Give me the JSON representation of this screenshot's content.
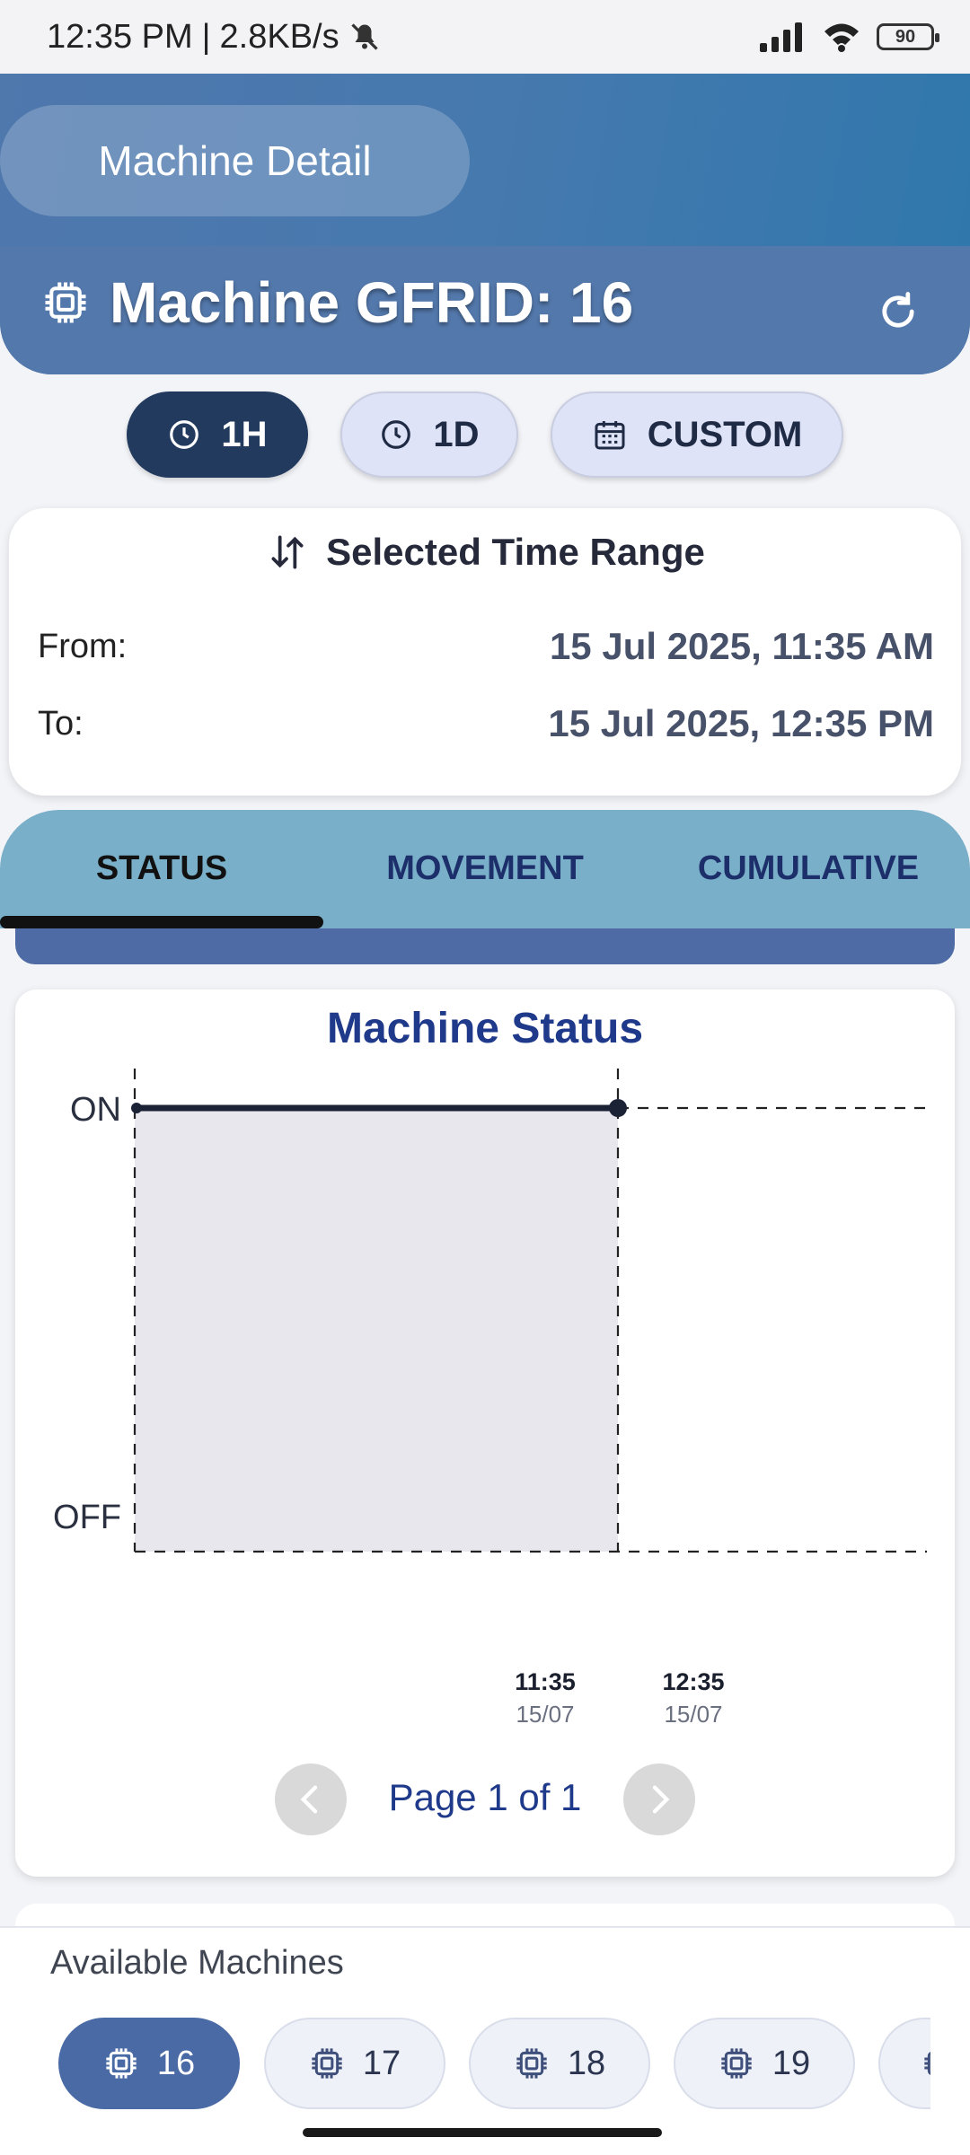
{
  "status_bar": {
    "time": "12:35 PM",
    "network_speed": "2.8KB/s",
    "battery": "90"
  },
  "header": {
    "page_title": "Machine Detail",
    "machine_title": "Machine GFRID: 16"
  },
  "range_chips": {
    "one_hour": "1H",
    "one_day": "1D",
    "custom": "CUSTOM"
  },
  "time_range": {
    "heading": "Selected Time Range",
    "from_label": "From:",
    "from_value": "15 Jul 2025, 11:35 AM",
    "to_label": "To:",
    "to_value": "15 Jul 2025, 12:35 PM"
  },
  "tabs": {
    "status": "STATUS",
    "movement": "MOVEMENT",
    "cumulative": "CUMULATIVE"
  },
  "chart": {
    "title": "Machine Status",
    "pager": "Page 1 of 1"
  },
  "chart_data": {
    "type": "line",
    "title": "Machine Status",
    "y_categories": [
      "OFF",
      "ON"
    ],
    "ticks": [
      {
        "time": "11:35",
        "date": "15/07"
      },
      {
        "time": "12:35",
        "date": "15/07"
      }
    ],
    "series": [
      {
        "points": [
          {
            "x": "11:35",
            "y": "ON"
          },
          {
            "x": "12:35",
            "y": "ON"
          }
        ]
      }
    ],
    "grid": "dashed"
  },
  "bottom": {
    "label": "Available Machines",
    "machines": [
      "16",
      "17",
      "18",
      "19"
    ]
  },
  "colors": {
    "header": "#5378ab",
    "active_chip": "#223a5e",
    "tabs": "#79afc8",
    "accent_text": "#1f3a8a"
  }
}
